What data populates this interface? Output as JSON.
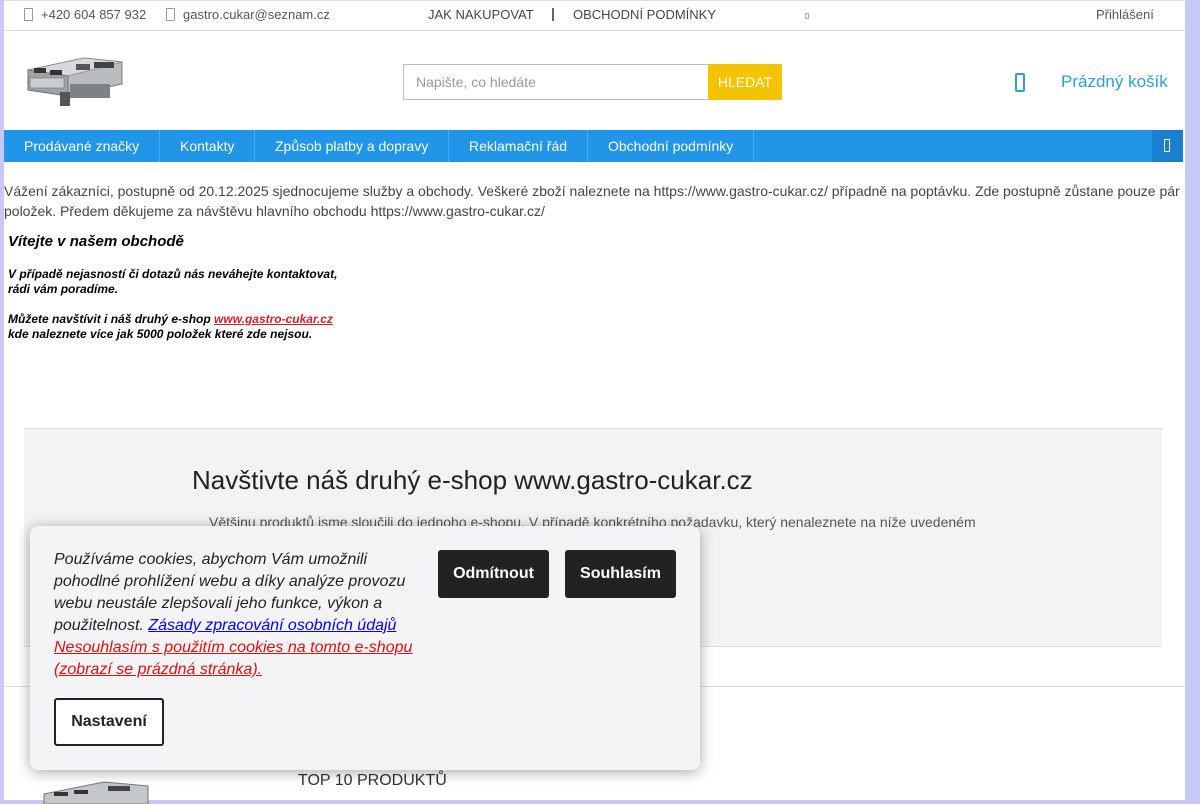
{
  "topbar": {
    "phone": "+420 604 857 932",
    "email": "gastro.cukar@seznam.cz",
    "nav": [
      "JAK NAKUPOVAT",
      "OBCHODNÍ PODMÍNKY"
    ],
    "login": "Přihlášení"
  },
  "search": {
    "placeholder": "Napište, co hledáte",
    "button": "HLEDAT"
  },
  "cart": {
    "label": "Prázdný košík"
  },
  "menu": {
    "items": [
      "Prodávané značky",
      "Kontakty",
      "Způsob platby a dopravy",
      "Reklamační řád",
      "Obchodní podmínky"
    ]
  },
  "notice": {
    "line1": "Vážení zákazníci, postupně od 20.12.2025 sjednocujeme služby a obchody. Veškeré zboží naleznete na https://www.gastro-cukar.cz/ případně na poptávku. Zde postupně zůstane pouze pár",
    "line2": "položek. Předem děkujeme za návštěvu hlavního obchodu https://www.gastro-cukar.cz/"
  },
  "welcome": {
    "heading": "Vítejte v našem obchodě",
    "line1": "V případě nejasností či dotazů nás neváhejte kontaktovat,",
    "line2": "rádi vám poradíme.",
    "line3_prefix": "Můžete navštívit i náš druhý e-shop ",
    "link": "www.gastro-cukar.cz",
    "line4": "kde naleznete více jak 5000 položek které zde nejsou."
  },
  "promo": {
    "title": "Navštivte náš druhý e-shop www.gastro-cukar.cz",
    "text": "Většinu produktů jsme sloučili do jednoho e-shopu. V případě konkrétního požadavku, který nenaleznete na níže uvedeném"
  },
  "section": {
    "top10": "TOP 10 PRODUKTŮ"
  },
  "cookie": {
    "text": "Používáme cookies, abychom Vám umožnili pohodlné prohlížení webu a díky analýze provozu webu neustále zlepšovali jeho funkce, výkon a použitelnost.",
    "policy_link": "Zásady zpracování osobních údajů",
    "decline_link": "Nesouhlasím s použitím cookies na tomto e-shopu (zobrazí se prázdná stránka).",
    "reject": "Odmítnout",
    "accept": "Souhlasím",
    "settings": "Nastavení"
  },
  "colors": {
    "menu": "#2196e8",
    "search_button": "#f5c400",
    "cart": "#2f9ce0",
    "link_red": "#d81e2c",
    "background": "#c9c9f6"
  }
}
